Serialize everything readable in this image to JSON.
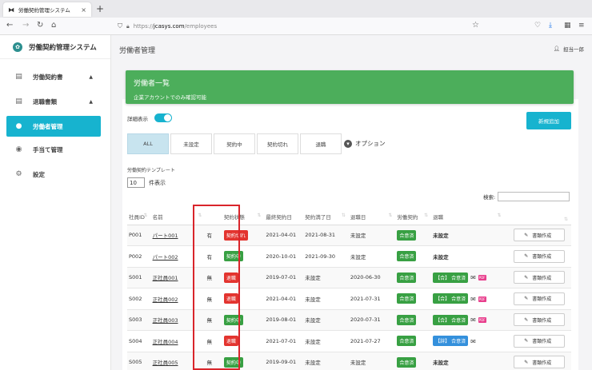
{
  "browser": {
    "tab_title": "労働契約管理システム",
    "url_prefix": "https://",
    "url_domain": "jcasys.com",
    "url_path": "/employees"
  },
  "sidebar": {
    "brand": "労働契約管理システム",
    "items": [
      {
        "label": "労働契約書",
        "icon": "document-icon",
        "caret": "▲"
      },
      {
        "label": "退職書類",
        "icon": "document-icon",
        "caret": "▲"
      },
      {
        "label": "労働者管理",
        "icon": "user-circle-icon",
        "caret": ""
      },
      {
        "label": "手当て管理",
        "icon": "user-circle-icon",
        "caret": ""
      },
      {
        "label": "設定",
        "icon": "gear-icon",
        "caret": ""
      }
    ]
  },
  "header": {
    "title": "労働者管理",
    "user": "担当一郎"
  },
  "banner": {
    "title": "労働者一覧",
    "subtitle": "企業アカウントでのみ確認可能"
  },
  "controls": {
    "detail_label": "詳細表示",
    "new_button": "新規追加",
    "filters": [
      "ALL",
      "未設定",
      "契約中",
      "契約切れ",
      "退職"
    ],
    "option_label": "オプション",
    "template_label": "労働契約テンプレート",
    "page_length": "10",
    "page_length_suffix": "件表示",
    "search_label": "検索:"
  },
  "table": {
    "headers": [
      "社員ID",
      "名前",
      "",
      "契約状態",
      "最終契約日",
      "契約満了日",
      "退職日",
      "労働契約",
      "退職",
      "",
      ""
    ],
    "rows": [
      {
        "id": "P001",
        "name": "パート001",
        "gender": "有",
        "status": "契約切れ",
        "status_color": "#e3342f",
        "last": "2021-04-01",
        "end": "2021-08-31",
        "retire": "未設定",
        "contract": "合意済",
        "retire_doc": "未設定",
        "retire_type": "",
        "retire_agree": "",
        "mail": false,
        "pdf": false,
        "action": "書類作成"
      },
      {
        "id": "P002",
        "name": "パート002",
        "gender": "有",
        "status": "契約中",
        "status_color": "#38a043",
        "last": "2020-10-01",
        "end": "2021-09-30",
        "retire": "未設定",
        "contract": "合意済",
        "retire_doc": "未設定",
        "retire_type": "",
        "retire_agree": "",
        "mail": false,
        "pdf": false,
        "action": "書類作成"
      },
      {
        "id": "S001",
        "name": "正社員001",
        "gender": "無",
        "status": "退職",
        "status_color": "#e3342f",
        "last": "2019-07-01",
        "end": "未設定",
        "retire": "2020-06-30",
        "contract": "合意済",
        "retire_doc": "",
        "retire_type": "【合】",
        "retire_agree": "合意済",
        "retire_color": "#38a043",
        "mail": true,
        "pdf": true,
        "action": "書類作成"
      },
      {
        "id": "S002",
        "name": "正社員002",
        "gender": "無",
        "status": "退職",
        "status_color": "#e3342f",
        "last": "2021-04-01",
        "end": "未設定",
        "retire": "2021-07-31",
        "contract": "合意済",
        "retire_doc": "",
        "retire_type": "【合】",
        "retire_agree": "合意済",
        "retire_color": "#38a043",
        "mail": true,
        "pdf": true,
        "action": "書類作成"
      },
      {
        "id": "S003",
        "name": "正社員003",
        "gender": "無",
        "status": "契約中",
        "status_color": "#38a043",
        "last": "2019-08-01",
        "end": "未設定",
        "retire": "2020-07-31",
        "contract": "合意済",
        "retire_doc": "",
        "retire_type": "【合】",
        "retire_agree": "合意済",
        "retire_color": "#38a043",
        "mail": true,
        "pdf": true,
        "action": "書類作成"
      },
      {
        "id": "S004",
        "name": "正社員004",
        "gender": "無",
        "status": "退職",
        "status_color": "#e3342f",
        "last": "2021-07-01",
        "end": "未設定",
        "retire": "2021-07-27",
        "contract": "合意済",
        "retire_doc": "",
        "retire_type": "【辞】",
        "retire_agree": "合意済",
        "retire_color": "#3490dc",
        "mail": true,
        "pdf": false,
        "action": "書類作成"
      },
      {
        "id": "S005",
        "name": "正社員005",
        "gender": "無",
        "status": "契約中",
        "status_color": "#38a043",
        "last": "2019-09-01",
        "end": "未設定",
        "retire": "未設定",
        "contract": "合意済",
        "retire_doc": "未設定",
        "retire_type": "",
        "retire_agree": "",
        "mail": false,
        "pdf": false,
        "action": "書類作成"
      }
    ]
  },
  "colors": {
    "accent": "#17b3cf",
    "banner": "#4cae5b",
    "highlight": "#d9252b"
  }
}
